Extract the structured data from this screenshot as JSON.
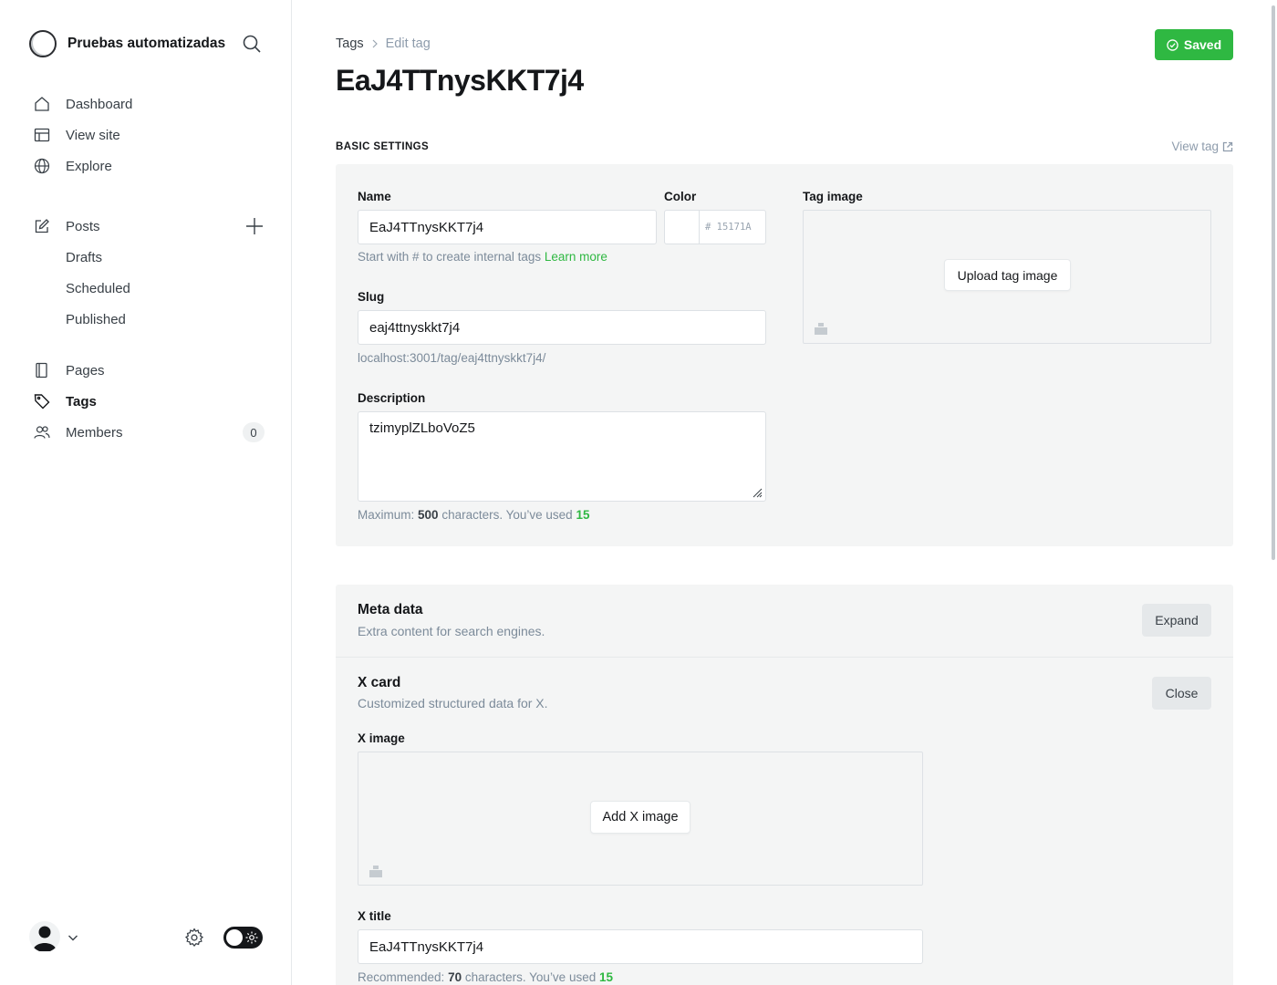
{
  "sidebar": {
    "site_name": "Pruebas automatizadas",
    "nav_main": [
      {
        "label": "Dashboard",
        "icon": "home-icon"
      },
      {
        "label": "View site",
        "icon": "layout-icon"
      },
      {
        "label": "Explore",
        "icon": "globe-icon"
      }
    ],
    "posts": {
      "label": "Posts",
      "icon": "edit-icon"
    },
    "posts_sub": [
      {
        "label": "Drafts"
      },
      {
        "label": "Scheduled"
      },
      {
        "label": "Published"
      }
    ],
    "nav_bottom": [
      {
        "label": "Pages",
        "icon": "page-icon"
      },
      {
        "label": "Tags",
        "icon": "tag-icon",
        "active": true
      },
      {
        "label": "Members",
        "icon": "members-icon",
        "count": "0"
      }
    ]
  },
  "header": {
    "breadcrumb_parent": "Tags",
    "breadcrumb_current": "Edit tag",
    "title": "EaJ4TTnysKKT7j4",
    "saved_label": "Saved",
    "saved_color": "#2fb842"
  },
  "basic": {
    "section_label": "BASIC SETTINGS",
    "view_tag_label": "View tag",
    "name_label": "Name",
    "name_value": "EaJ4TTnysKKT7j4",
    "name_hint": "Start with # to create internal tags",
    "name_hint_link": "Learn more",
    "color_label": "Color",
    "color_hash": "#",
    "color_placeholder": "15171A",
    "slug_label": "Slug",
    "slug_value": "eaj4ttnyskkt7j4",
    "slug_url": "localhost:3001/tag/eaj4ttnyskkt7j4/",
    "description_label": "Description",
    "description_value": "tzimyplZLboVoZ5",
    "desc_hint_prefix": "Maximum:",
    "desc_hint_max": "500",
    "desc_hint_mid": "characters. You’ve used",
    "desc_hint_used": "15",
    "tag_image_label": "Tag image",
    "upload_label": "Upload tag image"
  },
  "meta": {
    "title": "Meta data",
    "subtitle": "Extra content for search engines.",
    "button": "Expand"
  },
  "xcard": {
    "title": "X card",
    "subtitle": "Customized structured data for X.",
    "button": "Close",
    "image_label": "X image",
    "add_image_label": "Add X image",
    "xtitle_label": "X title",
    "xtitle_value": "EaJ4TTnysKKT7j4",
    "hint_prefix": "Recommended:",
    "hint_max": "70",
    "hint_mid": "characters. You’ve used",
    "hint_used": "15"
  }
}
